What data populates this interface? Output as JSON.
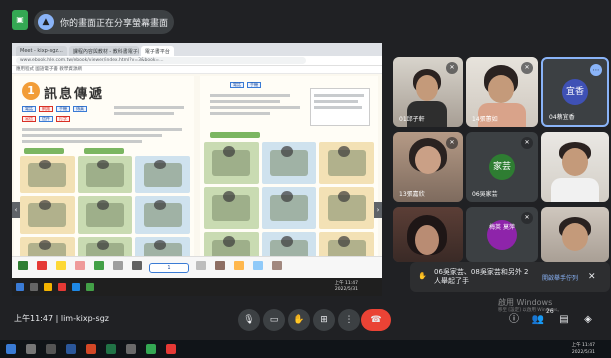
{
  "presenting_banner": {
    "icon": "present-icon",
    "text": "你的畫面正在分享螢幕畫面"
  },
  "browser": {
    "tabs": [
      "Meet - kixp-sgz...",
      "課程內容與教材 - 教科書電子書",
      "電子書平台"
    ],
    "address": "www.ebook.hle.com.tw/ebook/viewer/index.html?v=3&book=...",
    "bookmarks": "應用程式    國語電子書    教學資源網"
  },
  "ebook": {
    "lesson_number": "1",
    "lesson_title": "訊息傳遞",
    "vocab_top": [
      "電話",
      "手機",
      "傳真",
      "信件"
    ],
    "vocab_red": [
      "網路",
      "寫信",
      "打字"
    ],
    "pager_label": "1",
    "tools": [
      "icon",
      "icon",
      "icon",
      "icon",
      "icon",
      "icon",
      "icon",
      "icon",
      "icon",
      "icon",
      "icon",
      "icon",
      "icon"
    ],
    "inner_clock_time": "上午 11:47",
    "inner_clock_date": "2022/5/31"
  },
  "participants": [
    {
      "name": "01邱子軒",
      "type": "video",
      "mic_off": true
    },
    {
      "name": "14張蕙如",
      "type": "video",
      "mic_off": true
    },
    {
      "name": "04蔡宜香",
      "type": "avatar",
      "avatar_text": "宜香",
      "avatar_color": "#3f51b5",
      "selected": true
    },
    {
      "name": "13張嘉欣",
      "type": "video",
      "mic_off": true
    },
    {
      "name": "06吳家芸",
      "type": "avatar",
      "avatar_text": "家芸",
      "avatar_color": "#2e7d32",
      "mic_off": true
    },
    {
      "name": "",
      "type": "video",
      "mic_off": false
    },
    {
      "name": "",
      "type": "video",
      "mic_off": false
    },
    {
      "name": "",
      "type": "avatar",
      "avatar_text": "梅英 莫萍",
      "avatar_color": "#8e24aa",
      "mic_off": true
    },
    {
      "name": "",
      "type": "video",
      "mic_off": false
    }
  ],
  "notification": {
    "message": "06吳家芸、08吳家芸和另外 2 人舉起了手",
    "link": "開啟舉手佇列",
    "close": "✕"
  },
  "bottom": {
    "time": "上午11:47",
    "meeting_code": "lim-kixp-sgz",
    "controls": [
      "mic-icon",
      "camera-icon",
      "raise-hand-icon",
      "present-icon",
      "more-icon",
      "end-call-icon"
    ],
    "right_icons": [
      "info-icon",
      "people-icon",
      "chat-icon",
      "activities-icon"
    ],
    "participant_count": "26"
  },
  "watermark": {
    "line1": "啟用 Windows",
    "line2": "移至 [設定] 以啟用 Windows。"
  },
  "windows_taskbar": {
    "time": "上午 11:47",
    "date": "2022/5/31"
  },
  "colors": {
    "meet_bg": "#202124",
    "tile_bg": "#3c4043",
    "accent": "#8ab4f8",
    "end_call": "#ea4335"
  }
}
